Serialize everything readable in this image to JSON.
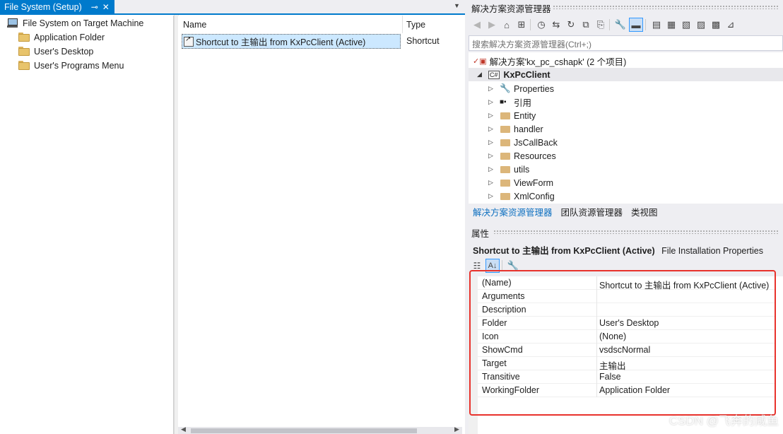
{
  "document": {
    "tab_title": "File System (Setup)",
    "pin_glyph": "⊸",
    "close_glyph": "✕",
    "dropdown_glyph": "▼"
  },
  "file_system_tree": {
    "root": "File System on Target Machine",
    "items": [
      {
        "label": "Application Folder",
        "icon": "folder-icon"
      },
      {
        "label": "User's Desktop",
        "icon": "folder-icon"
      },
      {
        "label": "User's Programs Menu",
        "icon": "folder-icon"
      }
    ]
  },
  "file_list": {
    "columns": [
      "Name",
      "Type"
    ],
    "rows": [
      {
        "name": "Shortcut to 主输出 from KxPcClient (Active)",
        "type": "Shortcut",
        "icon": "shortcut-icon"
      }
    ]
  },
  "solution_explorer": {
    "title": "解决方案资源管理器",
    "search_placeholder": "搜索解决方案资源管理器(Ctrl+;)",
    "solution_label": "解决方案'kx_pc_cshapk' (2 个项目)",
    "project_label": "KxPcClient",
    "project_badge": "C#",
    "nodes": [
      "Properties",
      "引用",
      "Entity",
      "handler",
      "JsCallBack",
      "Resources",
      "utils",
      "ViewForm",
      "XmlConfig"
    ],
    "bottom_tabs": [
      "解决方案资源管理器",
      "团队资源管理器",
      "类视图"
    ]
  },
  "properties": {
    "title": "属性",
    "object_name": "Shortcut to 主输出 from KxPcClient (Active)",
    "object_type": "File Installation Properties",
    "rows": [
      {
        "name": "(Name)",
        "value": "Shortcut to 主输出 from KxPcClient (Active)"
      },
      {
        "name": "Arguments",
        "value": ""
      },
      {
        "name": "Description",
        "value": ""
      },
      {
        "name": "Folder",
        "value": "User's Desktop"
      },
      {
        "name": "Icon",
        "value": "(None)"
      },
      {
        "name": "ShowCmd",
        "value": "vsdscNormal"
      },
      {
        "name": "Target",
        "value": "主输出"
      },
      {
        "name": "Transitive",
        "value": "False"
      },
      {
        "name": "WorkingFolder",
        "value": "Application Folder"
      }
    ]
  },
  "watermark": "CSDN @飞奔的咸鱼",
  "colors": {
    "accent": "#007acc",
    "selection": "#cce8ff",
    "highlight_box": "#e8322c"
  }
}
